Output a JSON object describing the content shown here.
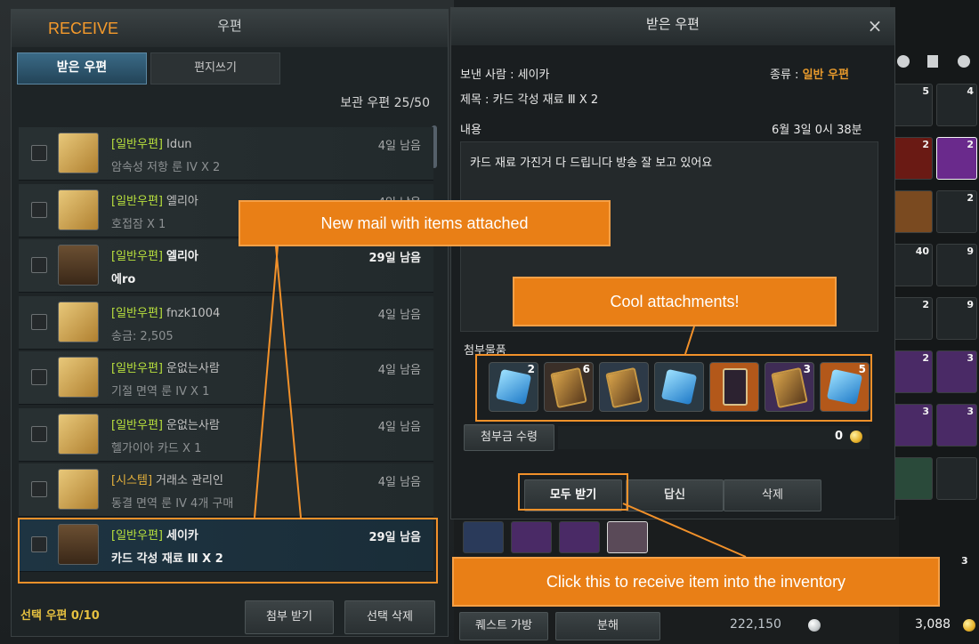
{
  "mail_window": {
    "title": "우편",
    "tab_received": "받은 우편",
    "tab_write": "편지쓰기",
    "storage": "보관 우편 25/50",
    "selected_count": "선택 우편 0/10",
    "btn_receive_attached": "첨부 받기",
    "btn_delete_selected": "선택 삭제",
    "rows": [
      {
        "tag": "[일반우편]",
        "sender": "Idun",
        "subject": "암속성 저항 룬 IV X 2",
        "days": "4일 남음",
        "icon": "envelope-icon"
      },
      {
        "tag": "[일반우편]",
        "sender": "엘리아",
        "subject": "호접잠 X 1",
        "days": "4일 남음",
        "icon": "envelope-icon"
      },
      {
        "tag": "[일반우편]",
        "sender": "엘리아",
        "subject": "에ro",
        "days": "29일 남음",
        "icon": "chest-icon"
      },
      {
        "tag": "[일반우편]",
        "sender": "fnzk1004",
        "subject": "송금: 2,505",
        "days": "4일 남음",
        "icon": "envelope-icon"
      },
      {
        "tag": "[일반우편]",
        "sender": "운없는사람",
        "subject": "기절 면역 룬 IV X 1",
        "days": "4일 남음",
        "icon": "envelope-icon"
      },
      {
        "tag": "[일반우편]",
        "sender": "운없는사람",
        "subject": "헬가이아 카드 X 1",
        "days": "4일 남음",
        "icon": "envelope-icon"
      },
      {
        "tag": "[시스템]",
        "sender": "거래소 관리인",
        "subject": "동결 면역 룬 IV 4개 구매",
        "days": "4일 남음",
        "icon": "envelope-icon"
      },
      {
        "tag": "[일반우편]",
        "sender": "세이카",
        "subject": "카드 각성 재료 Ⅲ X 2",
        "days": "29일 남음",
        "icon": "chest-icon"
      }
    ]
  },
  "detail_window": {
    "title": "받은 우편",
    "close": "×",
    "sender_label": "보낸 사람 : 세이카",
    "type_label": "종류 :",
    "type_value": "일반 우편",
    "subject_label": "제목 :  카드 각성 재료 Ⅲ X 2",
    "content_label": "내용",
    "date": "6월 3일 0시 38분",
    "body": "카드 재료 가진거 다 드립니다 방송 잘 보고 있어요",
    "attach_label": "첨부물품",
    "attachments": [
      {
        "icon": "blue-cube-icon",
        "count": "2",
        "bg": "#2b3a44"
      },
      {
        "icon": "card-icon",
        "count": "6",
        "bg": "#3a2f28"
      },
      {
        "icon": "card-icon",
        "count": "",
        "bg": "#2d3a48"
      },
      {
        "icon": "blue-cube-icon",
        "count": "",
        "bg": "#2b3a44"
      },
      {
        "icon": "tarot-card-icon",
        "count": "",
        "bg": "#b3581a"
      },
      {
        "icon": "card-icon",
        "count": "3",
        "bg": "#3f2c55"
      },
      {
        "icon": "blue-cube-icon",
        "count": "5",
        "bg": "#b3581a"
      }
    ],
    "fee_button": "첨부금 수령",
    "fee_value": "0",
    "btn_receive_all": "모두 받기",
    "btn_reply": "답신",
    "btn_delete": "삭제"
  },
  "inventory": {
    "counts": [
      "5",
      "4",
      "2",
      "2",
      "2",
      "40",
      "9",
      "2",
      "9",
      "2",
      "3",
      "3",
      "3",
      "3"
    ],
    "quest_bag": "퀘스트 가방",
    "dismantle": "분해",
    "silver": "222,150",
    "gold": "3,088"
  },
  "annotations": {
    "receive": "RECEIVE",
    "new_mail": "New mail with items attached",
    "cool": "Cool attachments!",
    "click": "Click this to receive item into the inventory",
    "color": "#e97f16"
  }
}
